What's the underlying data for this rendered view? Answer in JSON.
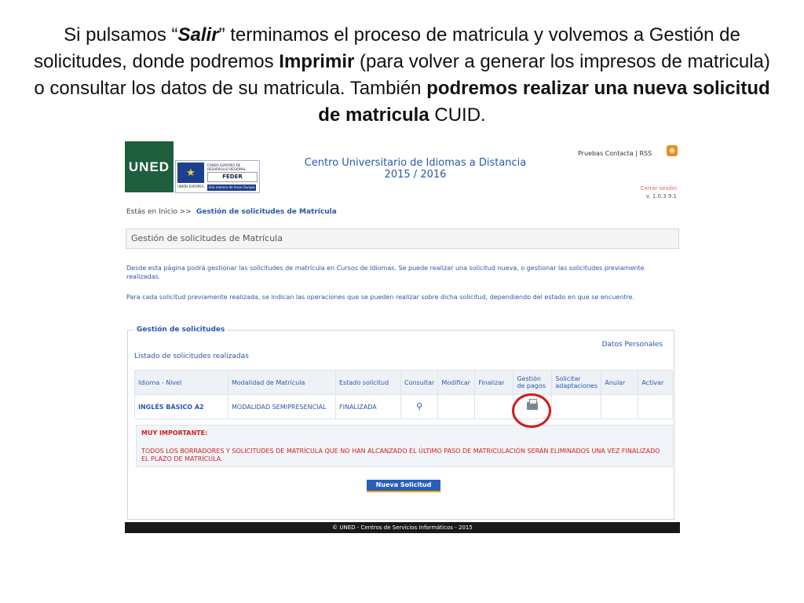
{
  "caption": {
    "p1": "Si pulsamos “",
    "salir": "Salir",
    "p2": "” terminamos el proceso de matricula y volvemos a Gestión de solicitudes, donde podremos ",
    "imprimir": "Imprimir",
    "p3": " (para volver a generar los impresos de matricula) o consultar los datos de su matricula. También ",
    "bold_podremos": "podremos realizar una nueva solicitud de matricula",
    "p4": " CUID."
  },
  "header": {
    "logo": "UNED",
    "eu_small": "FONDO EUROPEO DE DESARROLLO REGIONAL",
    "feder": "FEDER",
    "union": "UNIÓN EUROPEA",
    "eu_slogan": "Una manera de hacer Europa",
    "title1": "Centro Universitario de Idiomas a Distancia",
    "title2": "2015 / 2016",
    "toplinks": "Pruebas Contacta  |  RSS",
    "logout": "Cerrar sesión",
    "version": "v. 1.0.3.9.1"
  },
  "breadcrumb": {
    "prefix": "Estás en Inicio >>",
    "current": "Gestión de solicitudes de Matrícula"
  },
  "page_title": "Gestión de solicitudes de Matrícula",
  "description": {
    "p1": "Desde esta página podrá gestionar las solicitudes de matrícula en Cursos de Idiomas. Se puede realizar una solicitud nueva, o gestionar las solicitudes previamente realizadas.",
    "p2": "Para cada solicitud previamente realizada, se indican las operaciones que se pueden realizar sobre dicha solicitud, dependiendo del estado en que se encuentre."
  },
  "panel": {
    "legend": "Gestión de solicitudes",
    "datos_personales": "Datos Personales",
    "listado": "Listado de solicitudes realizadas"
  },
  "table": {
    "headers": [
      "Idioma - Nivel",
      "Modalidad de Matrícula",
      "Estado solicitud",
      "Consultar",
      "Modificar",
      "Finalizar",
      "Gestión de pagos",
      "Solicitar adaptaciones",
      "Anular",
      "Activar"
    ],
    "row": {
      "idioma": "INGLÉS BÁSICO A2",
      "modalidad": "MODALIDAD SEMIPRESENCIAL",
      "estado": "FINALIZADA"
    }
  },
  "warning": {
    "title": "MUY IMPORTANTE:",
    "text": "TODOS LOS BORRADORES Y SOLICITUDES DE MATRÍCULA QUE NO HAN ALCANZADO EL ÚLTIMO PASO DE MATRICULACIÓN SERÁN ELIMINADOS UNA VEZ FINALIZADO EL PLAZO DE MATRÍCULA."
  },
  "buttons": {
    "nueva": "Nueva Solicitud"
  },
  "footer": "© UNED - Centros de Servicios Informáticos - 2015",
  "colors": {
    "accent": "#2a58a8",
    "warning": "#d01c1c",
    "uned_green": "#1f5e3d"
  }
}
